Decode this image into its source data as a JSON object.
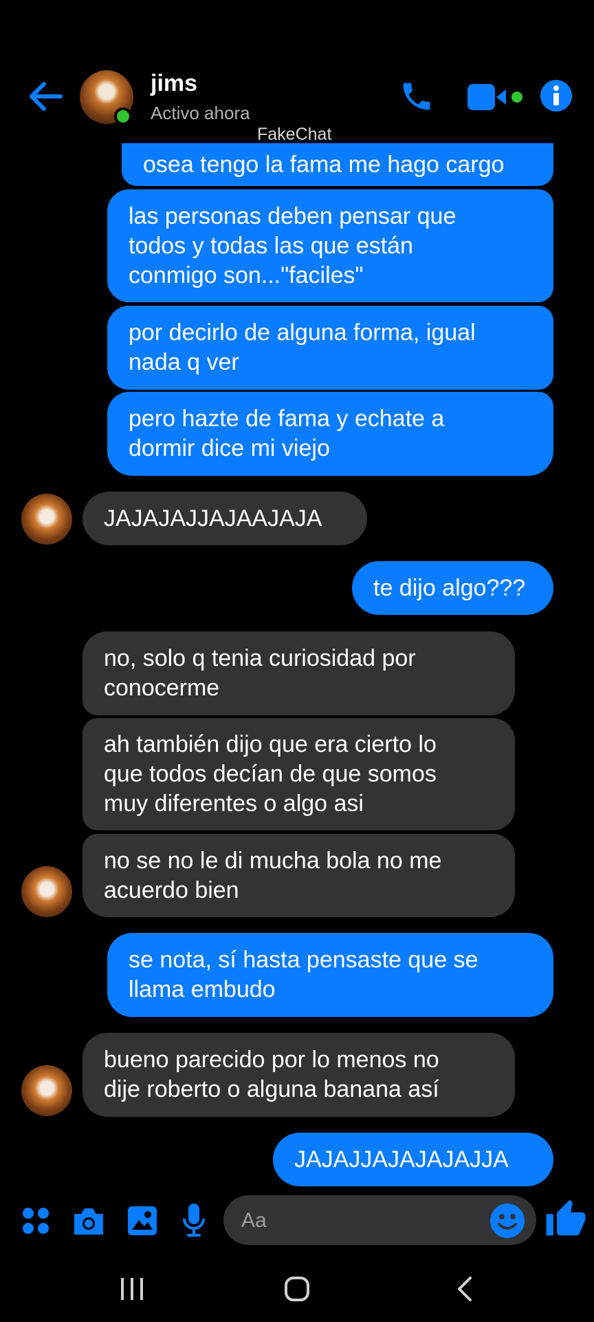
{
  "header": {
    "contact_name": "jims",
    "status": "Activo ahora",
    "watermark": "FakeChat"
  },
  "messages": [
    {
      "side": "out",
      "text": "osea tengo la fama me hago cargo"
    },
    {
      "side": "out",
      "text": "las personas deben pensar que\ntodos y todas las que están\nconmigo son...\"faciles\""
    },
    {
      "side": "out",
      "text": "por decirlo de alguna forma, igual\nnada q ver"
    },
    {
      "side": "out",
      "text": "pero hazte de fama y echate a\ndormir dice mi viejo"
    },
    {
      "side": "in",
      "text": "JAJAJAJJAJAAJAJA"
    },
    {
      "side": "out",
      "text": "te dijo algo???"
    },
    {
      "side": "in",
      "text": "no, solo q tenia curiosidad por\nconocerme"
    },
    {
      "side": "in",
      "text": "ah también dijo que era cierto lo\nque todos decían de que somos\nmuy diferentes o algo asi"
    },
    {
      "side": "in",
      "text": "no se no le di mucha bola no me\nacuerdo bien"
    },
    {
      "side": "out",
      "text": "se nota, sí hasta pensaste que se\nllama embudo"
    },
    {
      "side": "in",
      "text": "bueno parecido por lo menos no\ndije roberto o alguna banana así"
    },
    {
      "side": "out",
      "text": "JAJAJJAJAJAJAJJA"
    }
  ],
  "composer": {
    "placeholder": "Aa",
    "icons": [
      "apps-icon",
      "camera-icon",
      "image-icon",
      "mic-icon",
      "emoji-icon",
      "thumbs-up-icon"
    ]
  },
  "colors": {
    "accent": "#0a7cff",
    "incoming": "#333335",
    "online": "#31c531"
  }
}
